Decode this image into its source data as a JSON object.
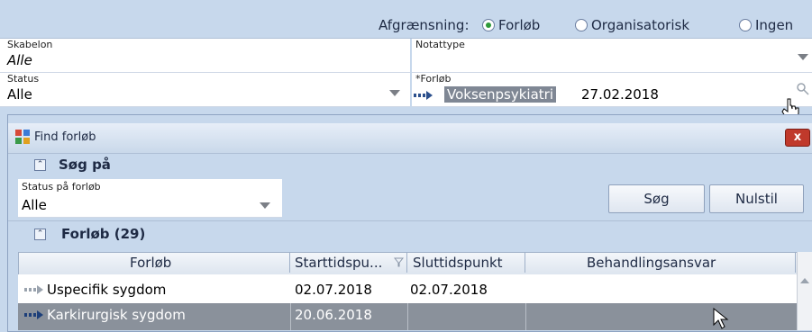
{
  "filter": {
    "label": "Afgrænsning:",
    "options": [
      "Forløb",
      "Organisatorisk",
      "Ingen"
    ],
    "selected": "Forløb"
  },
  "fields": {
    "skabelon": {
      "label": "Skabelon",
      "value": "Alle"
    },
    "notattype": {
      "label": "Notattype",
      "value": ""
    },
    "status": {
      "label": "Status",
      "value": "Alle"
    },
    "forloeb": {
      "label": "*Forløb",
      "value_highlight": "Voksenpsykiatri",
      "value_date": "27.02.2018"
    }
  },
  "dialog": {
    "title": "Find forløb",
    "close_label": "x",
    "search_section": "Søg på",
    "status_field": {
      "label": "Status på forløb",
      "value": "Alle"
    },
    "search_button": "Søg",
    "reset_button": "Nulstil",
    "results_section": "Forløb (29)",
    "columns": [
      "Forløb",
      "Starttidspu...",
      "Sluttidspunkt",
      "Behandlingsansvar"
    ],
    "rows": [
      {
        "forloeb": "Uspecifik sygdom",
        "start": "02.07.2018",
        "slut": "02.07.2018",
        "ansvar": ""
      },
      {
        "forloeb": "Karkirurgisk sygdom",
        "start": "20.06.2018",
        "slut": "",
        "ansvar": ""
      }
    ]
  },
  "colors": {
    "background": "#c7d8ec",
    "selected_row": "#8a919b",
    "radio_selected": "#2f9a3a"
  }
}
